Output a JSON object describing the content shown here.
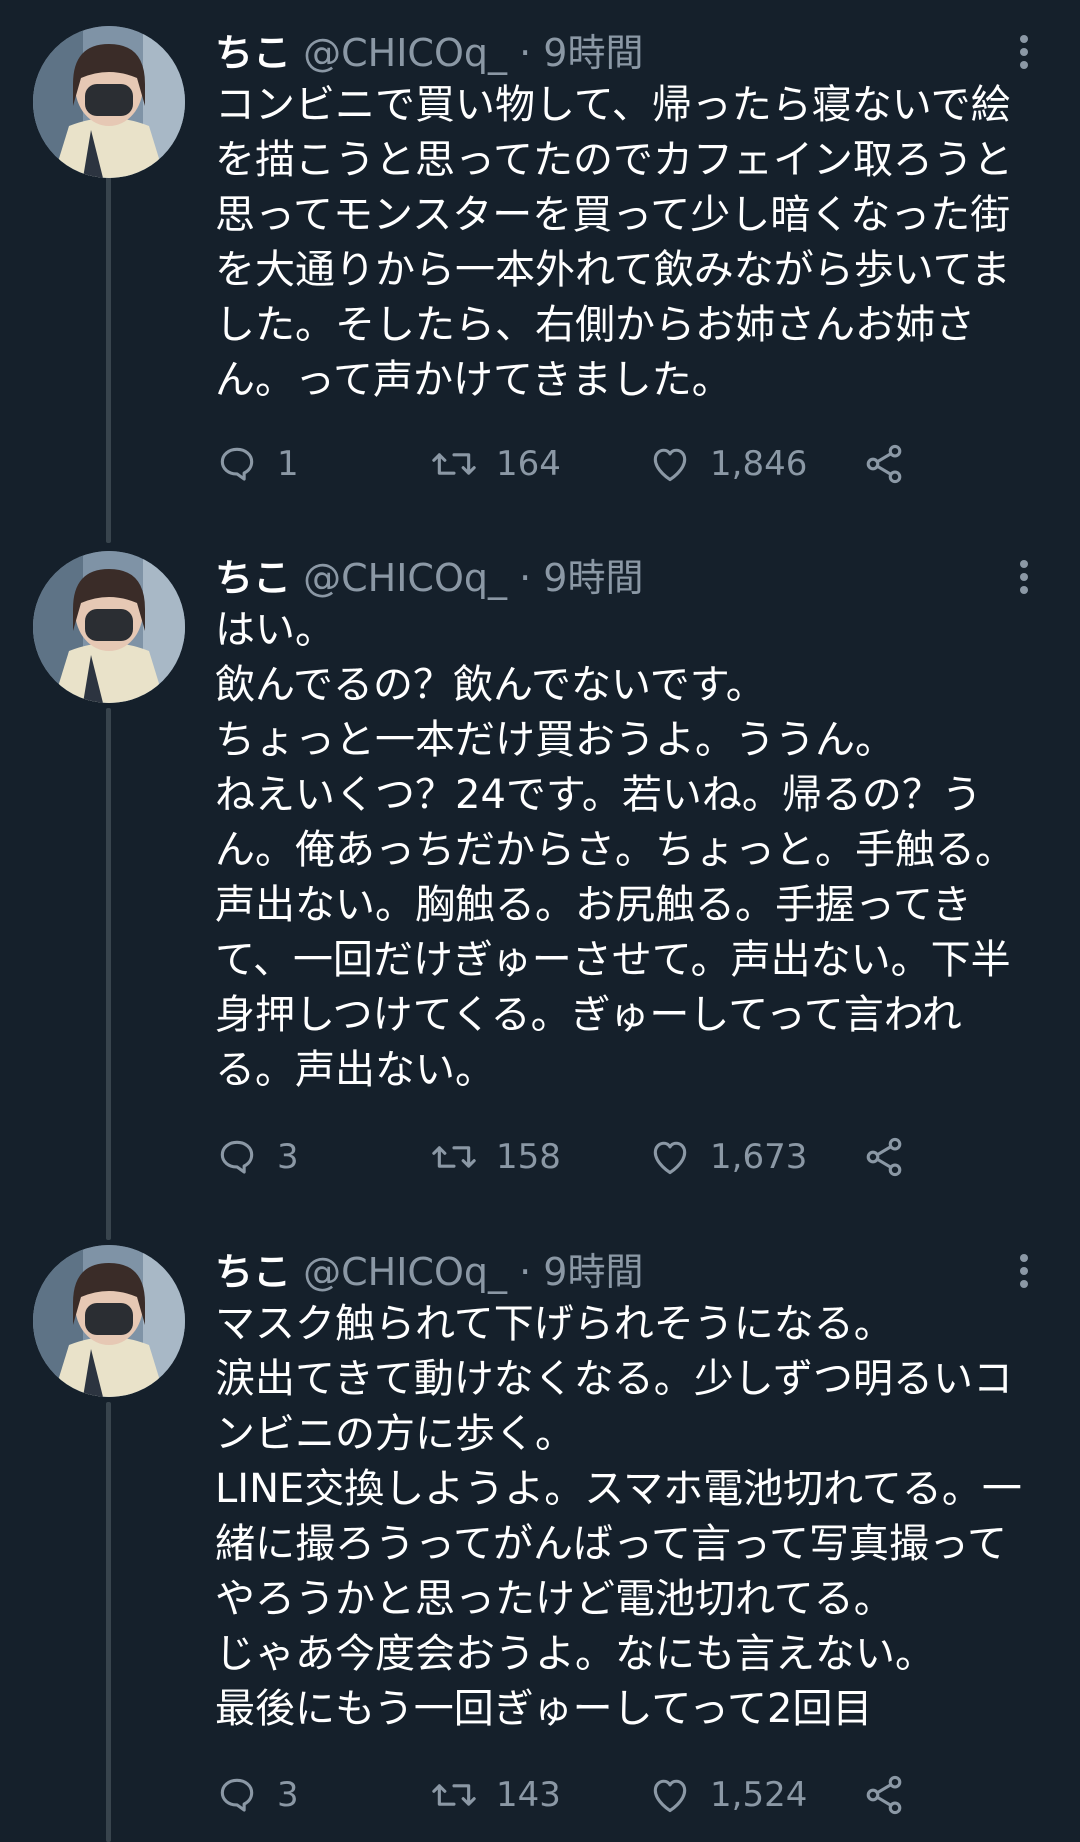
{
  "tweets": [
    {
      "name": "ちこ",
      "handle": "@CHICOq_",
      "separator": "·",
      "time": "9時間",
      "text": "コンビニで買い物して、帰ったら寝ないで絵\nを描こうと思ってたのでカフェイン取ろうと\n思ってモンスターを買って少し暗くなった街\nを大通りから一本外れて飲みながら歩いてま\nした。そしたら、右側からお姉さんお姉さ\nん。って声かけてきました。",
      "replies": "1",
      "retweets": "164",
      "likes": "1,846"
    },
    {
      "name": "ちこ",
      "handle": "@CHICOq_",
      "separator": "·",
      "time": "9時間",
      "text": "はい。\n飲んでるの？飲んでないです。\nちょっと一本だけ買おうよ。ううん。\nねえいくつ？24です。若いね。帰るの？う\nん。俺あっちだからさ。ちょっと。手触る。\n声出ない。胸触る。お尻触る。手握ってき\nて、一回だけぎゅーさせて。声出ない。下半\n身押しつけてくる。ぎゅーしてって言われ\nる。声出ない。",
      "replies": "3",
      "retweets": "158",
      "likes": "1,673"
    },
    {
      "name": "ちこ",
      "handle": "@CHICOq_",
      "separator": "·",
      "time": "9時間",
      "text": "マスク触られて下げられそうになる。\n涙出てきて動けなくなる。少しずつ明るいコ\nンビニの方に歩く。\nLINE交換しようよ。スマホ電池切れてる。一\n緒に撮ろうってがんばって言って写真撮って\nやろうかと思ったけど電池切れてる。\nじゃあ今度会おうよ。なにも言えない。\n最後にもう一回ぎゅーしてって2回目",
      "replies": "3",
      "retweets": "143",
      "likes": "1,524"
    }
  ],
  "icons": {
    "reply": "reply-icon",
    "retweet": "retweet-icon",
    "like": "heart-icon",
    "share": "share-icon",
    "more": "more-vertical-icon"
  },
  "colors": {
    "background": "#15202b",
    "text": "#ffffff",
    "secondary": "#8b98a5",
    "thread_line": "#38444d"
  }
}
